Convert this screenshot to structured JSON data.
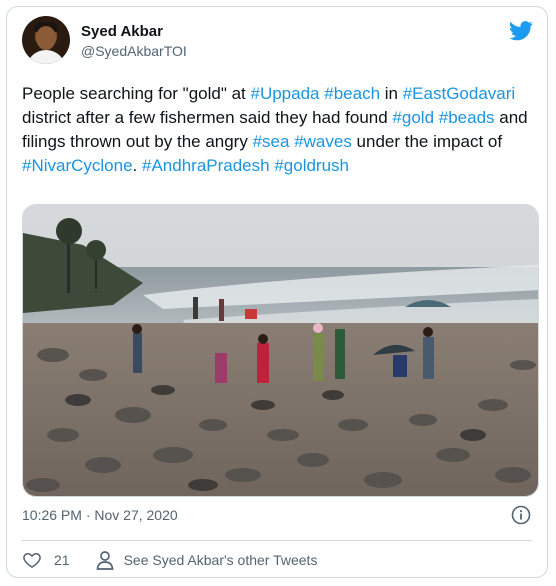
{
  "tweet": {
    "author_name": "Syed Akbar",
    "author_handle": "@SyedAkbarTOI",
    "text_segments": [
      {
        "text": "People searching for \"gold\" at ",
        "type": "plain"
      },
      {
        "text": "#Uppada",
        "type": "hashtag"
      },
      {
        "text": " ",
        "type": "plain"
      },
      {
        "text": "#beach",
        "type": "hashtag"
      },
      {
        "text": " in ",
        "type": "plain"
      },
      {
        "text": "#EastGodavari",
        "type": "hashtag"
      },
      {
        "text": " district after a few fishermen said they had found ",
        "type": "plain"
      },
      {
        "text": "#gold",
        "type": "hashtag"
      },
      {
        "text": " ",
        "type": "plain"
      },
      {
        "text": "#beads",
        "type": "hashtag"
      },
      {
        "text": " and filings thrown out by the angry ",
        "type": "plain"
      },
      {
        "text": "#sea",
        "type": "hashtag"
      },
      {
        "text": " ",
        "type": "plain"
      },
      {
        "text": "#waves",
        "type": "hashtag"
      },
      {
        "text": " under the impact of ",
        "type": "plain"
      },
      {
        "text": "#NivarCyclone",
        "type": "hashtag"
      },
      {
        "text": ". ",
        "type": "plain"
      },
      {
        "text": "#AndhraPradesh",
        "type": "hashtag"
      },
      {
        "text": " ",
        "type": "plain"
      },
      {
        "text": "#goldrush",
        "type": "hashtag"
      }
    ],
    "timestamp": "10:26 PM · Nov 27, 2020",
    "like_count": "21",
    "see_more_label": "See Syed Akbar's other Tweets"
  },
  "colors": {
    "hashtag": "#1b95e0",
    "text": "#0f1419",
    "secondary": "#536471",
    "twitter_blue": "#1d9bf0",
    "border": "#cfd9de"
  },
  "icons": {
    "brand": "twitter-bird-icon",
    "info": "info-icon",
    "like": "heart-icon",
    "profile": "person-icon"
  }
}
